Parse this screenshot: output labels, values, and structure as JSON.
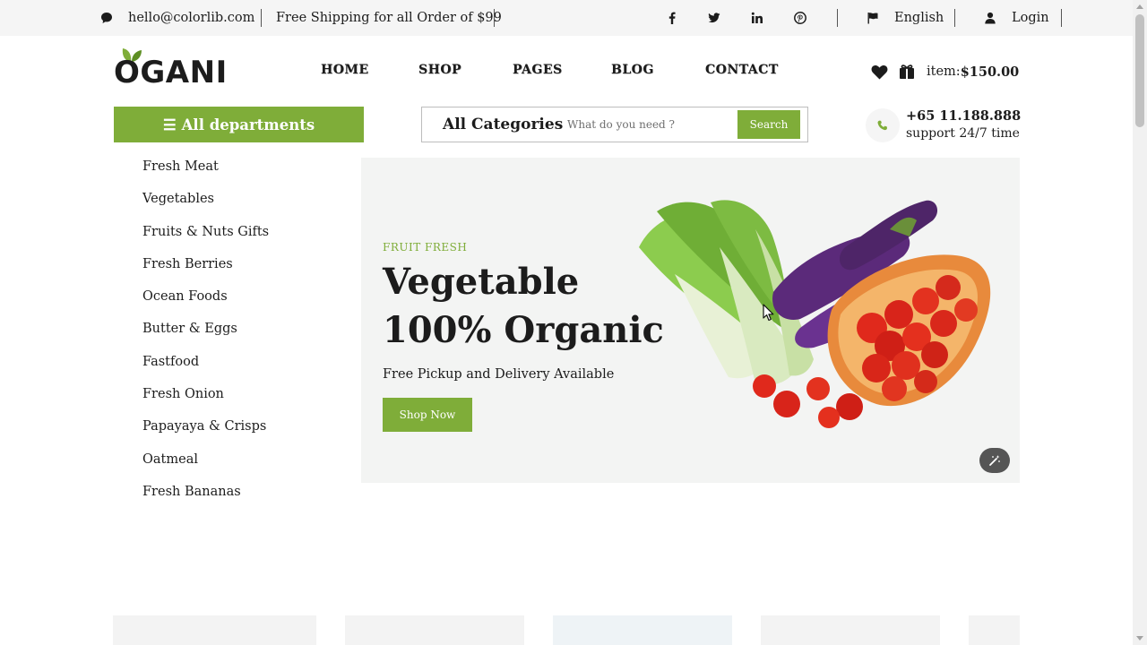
{
  "topbar": {
    "email": "hello@colorlib.com",
    "shipping": "Free Shipping for all Order of $99",
    "social_icons": [
      "facebook-icon",
      "twitter-icon",
      "linkedin-icon",
      "pinterest-icon"
    ],
    "language": "English",
    "login": "Login"
  },
  "header": {
    "logo_text": "OGANI",
    "nav": [
      "HOME",
      "SHOP",
      "PAGES",
      "BLOG",
      "CONTACT"
    ],
    "cart_label": "item:",
    "cart_total": "$150.00"
  },
  "departments": {
    "button_label": "All departments",
    "items": [
      "Fresh Meat",
      "Vegetables",
      "Fruits & Nuts Gifts",
      "Fresh Berries",
      "Ocean Foods",
      "Butter & Eggs",
      "Fastfood",
      "Fresh Onion",
      "Papayaya & Crisps",
      "Oatmeal",
      "Fresh Bananas"
    ]
  },
  "search": {
    "category": "All Categories",
    "placeholder": "What do you need ?",
    "button": "Search"
  },
  "contact": {
    "phone": "+65 11.188.888",
    "support": "support 24/7 time"
  },
  "hero": {
    "kicker": "FRUIT FRESH",
    "title_line1": "Vegetable",
    "title_line2": "100% Organic",
    "subtitle": "Free Pickup and Delivery Available",
    "cta": "Shop Now"
  },
  "colors": {
    "accent": "#7fad39",
    "text": "#1c1c1c",
    "topbar_bg": "#f5f5f5",
    "hero_bg": "#f3f4f3"
  }
}
